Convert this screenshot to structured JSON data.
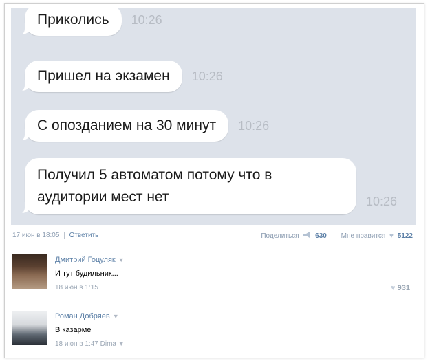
{
  "messages": [
    {
      "text": "Приколись",
      "time": "10:26"
    },
    {
      "text": "Пришел на экзамен",
      "time": "10:26"
    },
    {
      "text": "С опозданием на 30 минут",
      "time": "10:26"
    },
    {
      "text": "Получил 5 автоматом потому что в аудитории мест нет",
      "time": "10:26"
    }
  ],
  "post": {
    "date": "17 июн в 18:05",
    "separator": "|",
    "reply_label": "Ответить",
    "share_label": "Поделиться",
    "share_count": "630",
    "like_label": "Мне нравится",
    "like_count": "5122"
  },
  "comments": [
    {
      "author": "Дмитрий Гоцуляк",
      "text": "И тут будильник...",
      "date": "18 июн в 1:15",
      "likes": "931"
    },
    {
      "author": "Роман Добряев",
      "text": "В казарме",
      "date": "18 июн в 1:47",
      "via": "Dima"
    }
  ],
  "icons": {
    "share": "megaphone-icon",
    "like": "heart-icon",
    "more": "chevron-down-icon"
  },
  "colors": {
    "bubble": "#ffffff",
    "chat_bg": "#dde2ea",
    "link": "#5b7fa6",
    "time": "#b7bcc4"
  }
}
